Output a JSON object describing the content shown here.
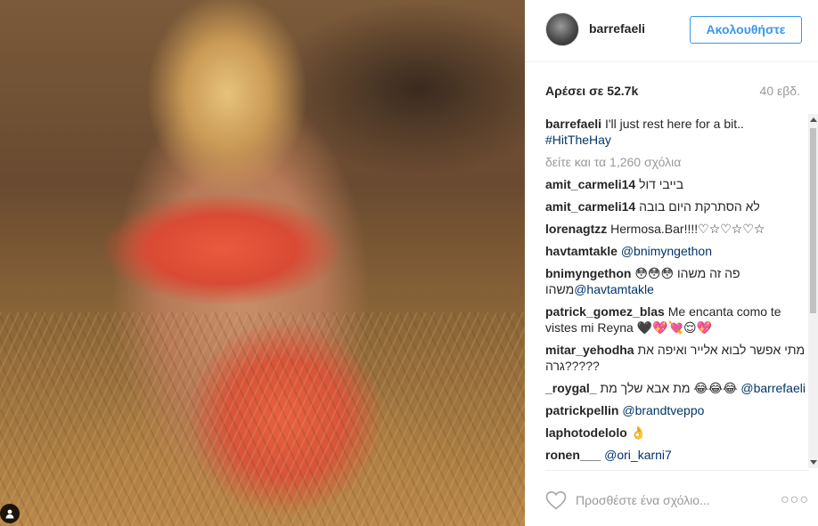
{
  "header": {
    "username": "barrefaeli",
    "follow_label": "Ακολουθήστε"
  },
  "stats": {
    "likes_label": "Αρέσει σε 52.7k",
    "timestamp": "40 εβδ."
  },
  "caption": {
    "username": "barrefaeli",
    "text": "I'll just rest here for a bit..",
    "hashtag": "#HitTheHay"
  },
  "load_more_label": "δείτε και τα 1,260 σχόλια",
  "comments": [
    {
      "user": "amit_carmeli14",
      "text": "בייבי דול"
    },
    {
      "user": "amit_carmeli14",
      "text": "לא הסתרקת היום בובה"
    },
    {
      "user": "lorenagtzz",
      "text": "Hermosa.Bar!!!!♡☆♡☆♡☆"
    },
    {
      "user": "havtamtakle",
      "mention": "@bnimyngethon"
    },
    {
      "user": "bnimyngethon",
      "text": "😳😳😳 פה זה משהו",
      "text2": "משהו",
      "mention2": "@havtamtakle"
    },
    {
      "user": "patrick_gomez_blas",
      "text": "Me encanta como te vistes mi Reyna 🖤💖💘😌💖"
    },
    {
      "user": "mitar_yehodha",
      "text": "מתי אפשר לבוא אלייר ואיפה את גרה?????"
    },
    {
      "user": "_roygal_",
      "text": "מת אבא שלך מת 😂😂😂",
      "mention": "@barrefaeli"
    },
    {
      "user": "patrickpellin",
      "mention": "@brandtveppo"
    },
    {
      "user": "laphotodelolo",
      "text": "👌"
    },
    {
      "user": "ronen___",
      "mention": "@ori_karni7"
    }
  ],
  "comment_box": {
    "placeholder": "Προσθέστε ένα σχόλιο..."
  },
  "icons": {
    "heart": "heart-outline-icon",
    "more": "more-options-icon",
    "user_tag": "user-tag-icon"
  },
  "colors": {
    "accent": "#3897f0",
    "link": "#003569",
    "muted": "#999999"
  }
}
